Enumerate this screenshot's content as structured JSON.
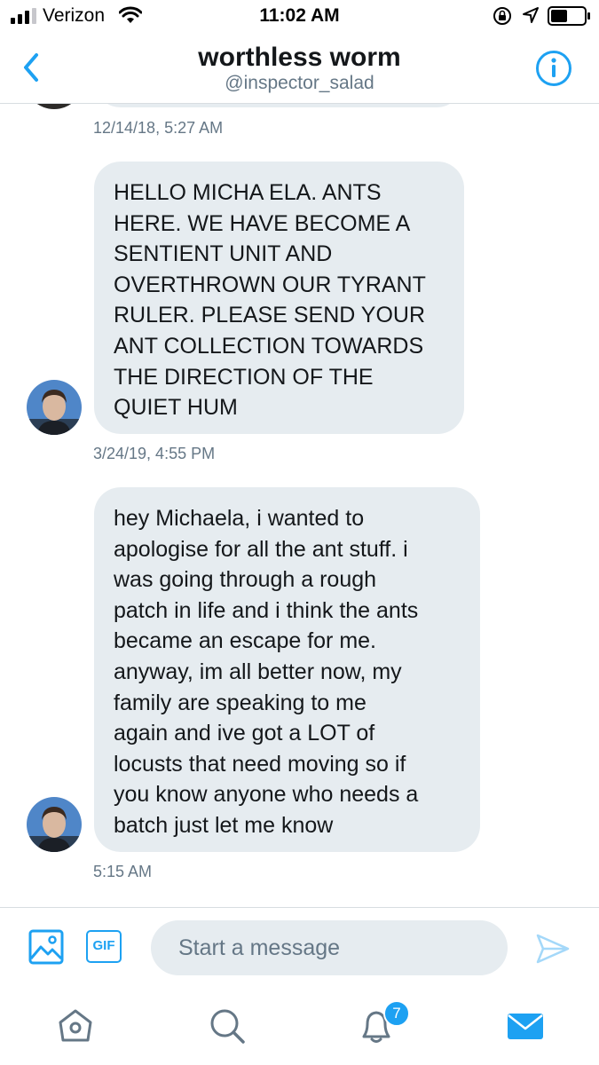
{
  "status_bar": {
    "carrier": "Verizon",
    "time": "11:02 AM",
    "battery_level": 0.5
  },
  "header": {
    "title": "worthless worm",
    "handle": "@inspector_salad"
  },
  "messages": [
    {
      "timestamp_before": "12/14/18, 5:27 AM",
      "lines": [
        "HELLO MICHA ELA. ANTS",
        "HERE. WE HAVE BECOME A",
        "SENTIENT UNIT AND",
        "OVERTHROWN OUR TYRANT",
        "RULER. PLEASE SEND YOUR",
        "ANT COLLECTION TOWARDS",
        "THE DIRECTION OF THE",
        "QUIET HUM"
      ]
    },
    {
      "timestamp_before": "3/24/19, 4:55 PM",
      "lines": [
        "hey Michaela, i wanted to",
        "apologise for all the ant stuff. i",
        "was going through a rough",
        "patch in life and i think the ants",
        "became an escape for me.",
        "anyway, im all better now, my",
        "family are speaking to me",
        "again and ive got a LOT of",
        "locusts that need moving so if",
        "you know anyone who needs a",
        "batch just let me know"
      ]
    }
  ],
  "last_timestamp": "5:15 AM",
  "composer": {
    "gif_label": "GIF",
    "placeholder": "Start a message"
  },
  "tabbar": {
    "notification_count": "7"
  },
  "colors": {
    "accent": "#1da1f2",
    "bubble": "#e6ecf0",
    "secondary_text": "#657786"
  },
  "icons": [
    "back-chevron-icon",
    "info-icon",
    "image-icon",
    "gif-icon",
    "send-icon",
    "home-icon",
    "search-icon",
    "bell-icon",
    "mail-icon"
  ]
}
